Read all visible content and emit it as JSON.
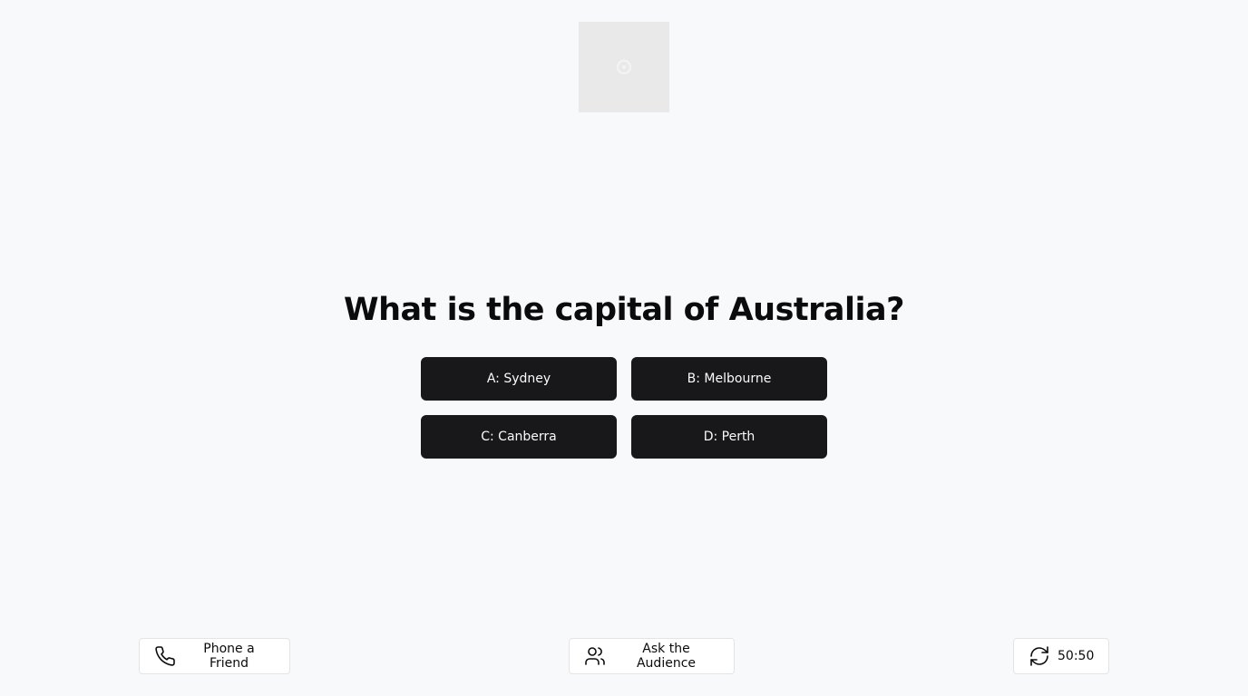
{
  "question": {
    "text": "What is the capital of Australia?"
  },
  "answers": [
    {
      "label": "A: Sydney"
    },
    {
      "label": "B: Melbourne"
    },
    {
      "label": "C: Canberra"
    },
    {
      "label": "D: Perth"
    }
  ],
  "lifelines": {
    "phone_friend": {
      "label": "Phone a Friend",
      "icon": "phone-icon"
    },
    "ask_audience": {
      "label": "Ask the Audience",
      "icon": "users-icon"
    },
    "fifty_fifty": {
      "label": "50:50",
      "icon": "refresh-icon"
    }
  },
  "logo": {
    "icon": "image-placeholder-icon"
  },
  "colors": {
    "background": "#f8f9fb",
    "answer_button": "#18181b",
    "answer_text": "#fafafa",
    "lifeline_border": "#e4e4e7"
  }
}
